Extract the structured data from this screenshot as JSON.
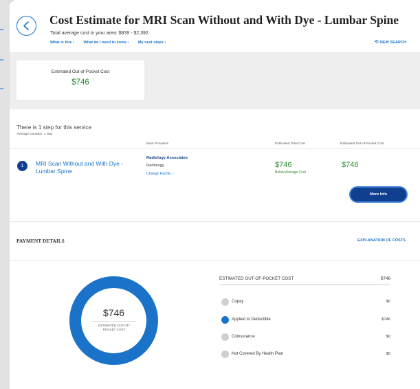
{
  "header": {
    "title": "Cost Estimate for MRI Scan Without and With Dye - Lumbar Spine",
    "avg_cost": "Total average cost in your area: $839 - $2,392",
    "links": [
      "What is this ›",
      "What do I need to know ›",
      "My next steps ›"
    ],
    "new_search": "NEW SEARCH"
  },
  "summary": {
    "oop_label": "Estimated Out-of-Pocket Cost",
    "oop_value": "$746"
  },
  "steps": {
    "title": "There is 1 step for this service",
    "duration": "Average Duration: 1 Day",
    "columns": [
      "Main Providers",
      "Estimated Total Cost",
      "Estimated Out-of-Pocket Cost"
    ],
    "items": [
      {
        "number": "1",
        "service": "MRI Scan Without and With Dye - Lumbar Spine",
        "provider": "Radiology Associates",
        "provider_type": "Radiology",
        "change_facility": "Change Facility ›",
        "total_cost": "$746",
        "total_note": "Below Average Cost",
        "oop_cost": "$746",
        "more_info": "More Info"
      }
    ]
  },
  "payment": {
    "title": "PAYMENT DETAILS",
    "explanation_link": "EXPLANATION OF COSTS",
    "donut": {
      "value": "$746",
      "label": "ESTIMATED OUT-OF-POCKET COST",
      "fill_fraction": 1.0,
      "color": "#1a73c8"
    },
    "breakdown_header": {
      "label": "ESTIMATED OUT-OF-POCKET COST",
      "value": "$746"
    },
    "breakdown": [
      {
        "label": "Copay",
        "value": "$0",
        "active": false
      },
      {
        "label": "Applied to Deductible",
        "value": "$746",
        "active": true
      },
      {
        "label": "Coinsurance",
        "value": "$0",
        "active": false
      },
      {
        "label": "Not Covered By Health Plan",
        "value": "$0",
        "active": false
      }
    ]
  },
  "colors": {
    "accent": "#1a73c8",
    "navy": "#0f3f8e",
    "money_green": "#2e8b2e"
  },
  "icons": [
    "chevron-left-icon",
    "refresh-icon"
  ]
}
